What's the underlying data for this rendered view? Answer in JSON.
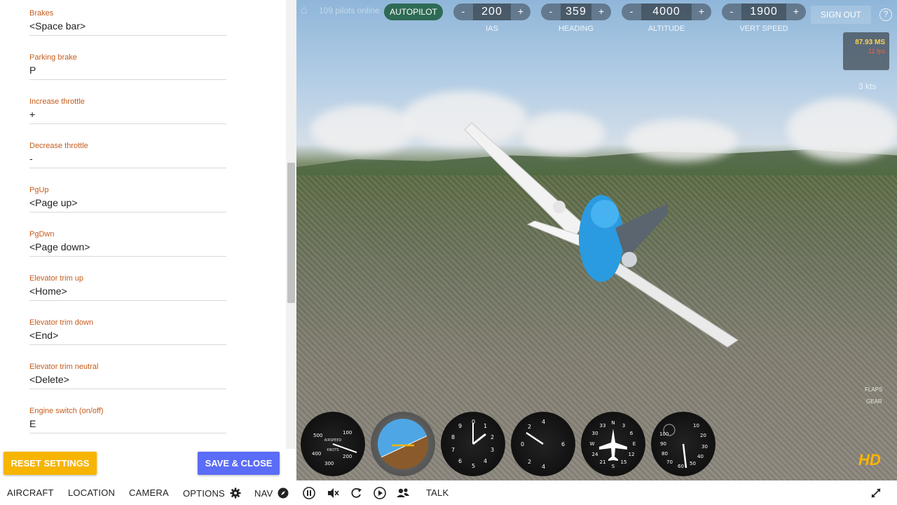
{
  "keybindings": [
    {
      "label": "Brakes",
      "value": "<Space bar>"
    },
    {
      "label": "Parking brake",
      "value": "P"
    },
    {
      "label": "Increase throttle",
      "value": "+"
    },
    {
      "label": "Decrease throttle",
      "value": "-"
    },
    {
      "label": "PgUp",
      "value": "<Page up>"
    },
    {
      "label": "PgDwn",
      "value": "<Page down>"
    },
    {
      "label": "Elevator trim up",
      "value": "<Home>"
    },
    {
      "label": "Elevator trim down",
      "value": "<End>"
    },
    {
      "label": "Elevator trim neutral",
      "value": "<Delete>"
    },
    {
      "label": "Engine switch (on/off)",
      "value": "E"
    }
  ],
  "buttons": {
    "reset": "RESET SETTINGS",
    "save": "SAVE & CLOSE",
    "autopilot": "AUTOPILOT",
    "signout": "SIGN OUT"
  },
  "top": {
    "pilots_online": "109 pilots online",
    "ap": {
      "ias": {
        "label": "IAS",
        "value": "200",
        "minus": "-",
        "plus": "+"
      },
      "heading": {
        "label": "HEADING",
        "value": "359",
        "minus": "-",
        "plus": "+"
      },
      "altitude": {
        "label": "ALTITUDE",
        "value": "4000",
        "minus": "-",
        "plus": "+"
      },
      "vertspeed": {
        "label": "VERT SPEED",
        "value": "1900",
        "minus": "-",
        "plus": "+"
      }
    }
  },
  "stats": {
    "ms": "87.93 MS",
    "fps": "11 fps",
    "wind": "3 kts"
  },
  "hud": {
    "flaps": "FLAPS",
    "gear": "GEAR",
    "hd": "HD"
  },
  "gauges": [
    {
      "name": "airspeed",
      "center_text": "AIRSPEED",
      "sub_text": "KNOTS",
      "ticks": [
        "100",
        "200",
        "300",
        "400",
        "500"
      ]
    },
    {
      "name": "attitude"
    },
    {
      "name": "altimeter",
      "ticks": [
        "0",
        "1",
        "2",
        "3",
        "4",
        "5",
        "6",
        "7",
        "8",
        "9"
      ]
    },
    {
      "name": "vsi",
      "ticks": [
        "0",
        "2",
        "4",
        "6",
        "4",
        "2"
      ]
    },
    {
      "name": "heading",
      "ticks": [
        "N",
        "3",
        "6",
        "E",
        "12",
        "15",
        "S",
        "21",
        "24",
        "W",
        "30",
        "33"
      ]
    },
    {
      "name": "tachometer",
      "ticks": [
        "10",
        "20",
        "30",
        "40",
        "50",
        "60",
        "70",
        "80",
        "90",
        "100"
      ]
    }
  ],
  "bottom_nav": {
    "aircraft": "AIRCRAFT",
    "location": "LOCATION",
    "camera": "CAMERA",
    "options": "OPTIONS",
    "nav": "NAV",
    "talk": "TALK"
  },
  "colors": {
    "label_orange": "#c65b1c",
    "reset_yellow": "#f7b500",
    "save_blue": "#5b6cf7",
    "autopilot_green": "#2e6b55",
    "hd_orange": "#ffb400"
  }
}
